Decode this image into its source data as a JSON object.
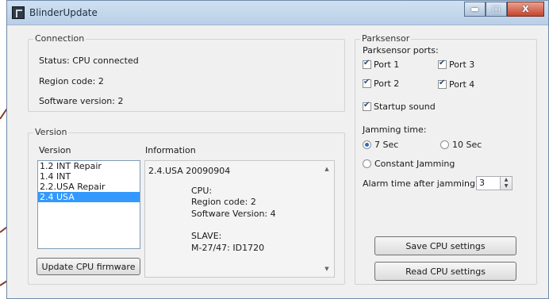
{
  "window": {
    "title": "BlinderUpdate",
    "controls": [
      "▬",
      "□",
      "X"
    ]
  },
  "connection": {
    "legend": "Connection",
    "status": "Status: CPU connected",
    "region": "Region code: 2",
    "software": "Software version: 2"
  },
  "version": {
    "legend": "Version",
    "list_header": "Version",
    "info_header": "Information",
    "items": [
      "1.2 INT Repair",
      "1.4 INT",
      "2.2.USA Repair",
      "2.4 USA"
    ],
    "selected_index": 3,
    "info": {
      "first_line": "2.4.USA  20090904",
      "cpu_heading": "CPU:",
      "cpu_region": "Region code:  2",
      "cpu_software": "Software Version: 4",
      "slave_heading": "SLAVE:",
      "slave_id": "M-27/47: ID1720"
    },
    "update_button": "Update CPU firmware"
  },
  "parksensor": {
    "legend": "Parksensor",
    "ports_label": "Parksensor ports:",
    "ports": [
      {
        "label": "Port 1",
        "checked": true
      },
      {
        "label": "Port 2",
        "checked": true
      },
      {
        "label": "Port 3",
        "checked": true
      },
      {
        "label": "Port 4",
        "checked": true
      }
    ],
    "startup_sound": {
      "label": "Startup sound",
      "checked": true
    },
    "jamming_label": "Jamming time:",
    "jamming_options": [
      {
        "label": "7 Sec",
        "checked": true
      },
      {
        "label": "10 Sec",
        "checked": false
      },
      {
        "label": "Constant Jamming",
        "checked": false
      }
    ],
    "alarm_label": "Alarm time after jamming:",
    "alarm_value": "3",
    "save_button": "Save CPU settings",
    "read_button": "Read CPU settings"
  },
  "colors": {
    "annotation_arrow": "#8a3a22",
    "selection": "#3399ff"
  }
}
